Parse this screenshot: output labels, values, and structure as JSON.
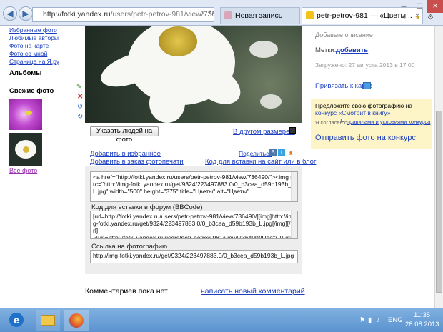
{
  "browser": {
    "url_host": "http://fotki.yandex.ru",
    "url_path": "/users/petr-petrov-981/view/736490/?page=0",
    "tabs": [
      {
        "label": "Новая запись"
      },
      {
        "label": "petr-petrov-981 — «Цветы..."
      }
    ]
  },
  "sidebar": {
    "links": [
      "Избранные фото",
      "Любимые авторы",
      "Фото на карте",
      "Фото со мной",
      "Страница на Я.ру"
    ],
    "albums_label": "Альбомы",
    "fresh_label": "Свежие фото",
    "all_photos": "Все фото"
  },
  "photo": {
    "tag_people_button": "Указать людей на фото",
    "other_size": "В другом размере ▾"
  },
  "actions": {
    "add_favorite": "Добавить в избранное",
    "add_print_order": "Добавить в заказ фотопечати",
    "share": "Поделиться",
    "embed_code_link": "Код для вставки на сайт или в блог"
  },
  "codes": {
    "html_code": "<a href=\"http://fotki.yandex.ru/users/petr-petrov-981/view/736490/\"><img src=\"http://img-fotki.yandex.ru/get/9324/223497883.0/0_b3cea_d59b193b_L.jpg\" width=\"500\" height=\"375\" title=\"Цветы\" alt=\"Цветы\"",
    "forum_label": "Код для вставки в форум (BBCode)",
    "forum_code": "[url=http://fotki.yandex.ru/users/petr-petrov-981/view/736490/][img]http://img-fotki.yandex.ru/get/9324/223497883.0/0_b3cea_d59b193b_L.jpg[/img][/url]\n«[url=http://fotki.yandex.ru/users/petr-petrov-981/view/736490/]Цветы[/url]» на [url=http://fotki.yandex.ru/]Яндекс.Фотках[/url]",
    "link_label": "Ссылка на фотографию",
    "link_code": "http://img-fotki.yandex.ru/get/9324/223497883.0/0_b3cea_d59b193b_L.jpg"
  },
  "comments": {
    "none": "Комментариев пока нет",
    "write": "написать новый комментарий"
  },
  "right": {
    "add_description": "Добавьте описание",
    "tags_label": "Метки:",
    "tags_add": "добавить",
    "uploaded": "Загружено: 27 августа 2013 в 17:00",
    "bind_map": "Привязать к карте",
    "contest_text": "Предложите свою фотографию на",
    "contest_link": "конкурс «Смотрит в книгу»",
    "agree_text": "Я согласен с",
    "agree_link": "правилами и условиями конкурса",
    "send_contest": "Отправить фото на конкурс"
  },
  "tray": {
    "lang": "ENG",
    "time": "11:35",
    "date": "28.08.2013"
  },
  "colors": {
    "link": "#1a3dc1",
    "contest_bg": "#fdf5c7",
    "taskbar": "#5b93cf"
  }
}
